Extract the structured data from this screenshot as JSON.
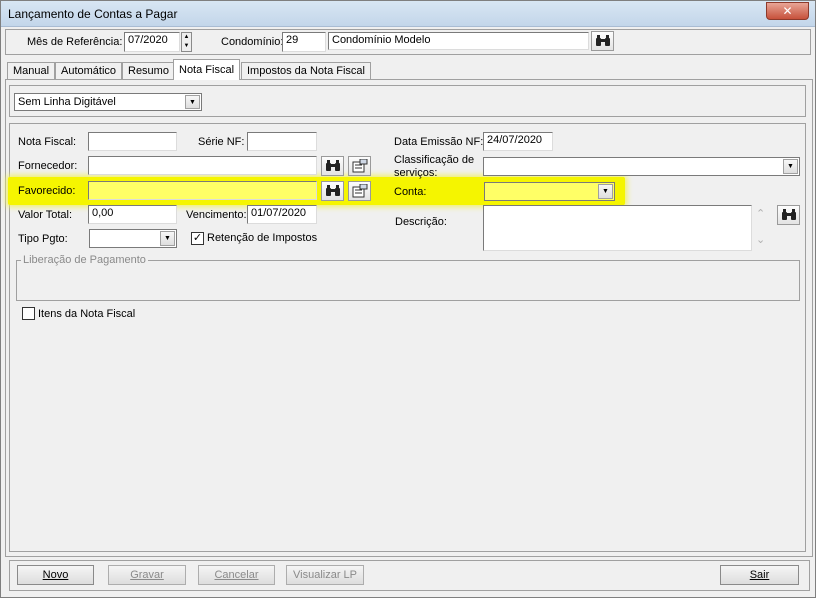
{
  "window": {
    "title": "Lançamento de Contas a Pagar",
    "close_glyph": "✕"
  },
  "header": {
    "mes_label": "Mês de Referência:",
    "mes_value": "07/2020",
    "condominio_label": "Condomínio:",
    "condominio_code": "29",
    "condominio_name": "Condomínio Modelo",
    "search_icon": "binoculars-icon"
  },
  "tabs": [
    {
      "label": "Manual"
    },
    {
      "label": "Automático"
    },
    {
      "label": "Resumo"
    },
    {
      "label": "Nota Fiscal",
      "active": true
    },
    {
      "label": "Impostos da Nota Fiscal"
    }
  ],
  "linha": {
    "selected": "Sem Linha Digitável"
  },
  "form": {
    "nota_fiscal_label": "Nota Fiscal:",
    "nota_fiscal_value": "",
    "serie_label": "Série NF:",
    "serie_value": "",
    "data_emissao_label": "Data Emissão NF:",
    "data_emissao_value": "24/07/2020",
    "fornecedor_label": "Fornecedor:",
    "fornecedor_value": "",
    "classificacao_label_1": "Classificação de",
    "classificacao_label_2": "serviços:",
    "classificacao_value": "",
    "favorecido_label": "Favorecido:",
    "favorecido_value": "",
    "conta_label": "Conta:",
    "conta_value": "",
    "valor_total_label": "Valor Total:",
    "valor_total_value": "0,00",
    "vencimento_label": "Vencimento:",
    "vencimento_value": "01/07/2020",
    "descricao_label": "Descrição:",
    "descricao_value": "",
    "tipo_pgto_label": "Tipo Pgto:",
    "tipo_pgto_value": "",
    "retencao_label": "Retenção de Impostos",
    "retencao_checked": true,
    "liberacao_legend": "Liberação de Pagamento",
    "itens_label": "Itens da Nota Fiscal",
    "itens_checked": false
  },
  "glyphs": {
    "check": "✓",
    "arrow_down": "▼",
    "up": "▲",
    "down": "▼",
    "binoculars": "👓",
    "scroll_up": "⌃",
    "scroll_down": "⌄"
  },
  "buttons": {
    "novo": "Novo",
    "gravar": "Gravar",
    "cancelar": "Cancelar",
    "visualizar": "Visualizar LP",
    "sair": "Sair"
  }
}
